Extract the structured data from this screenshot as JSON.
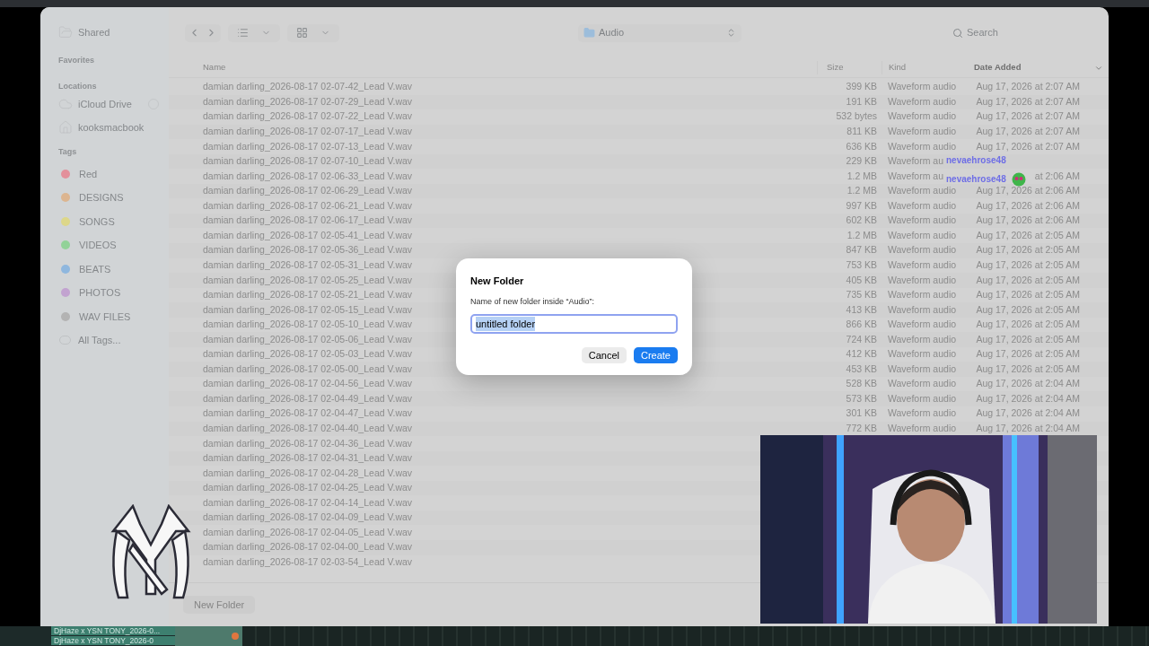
{
  "sidebar": {
    "shared": "Shared",
    "favorites_header": "Favorites",
    "locations_header": "Locations",
    "locations": [
      {
        "label": "iCloud Drive",
        "kind": "cloud"
      },
      {
        "label": "kooksmacbook",
        "kind": "home"
      }
    ],
    "tags_header": "Tags",
    "tags": [
      {
        "label": "Red",
        "color": "#e3909b"
      },
      {
        "label": "DESIGNS",
        "color": "#dcb590"
      },
      {
        "label": "SONGS",
        "color": "#ddd78a"
      },
      {
        "label": "VIDEOS",
        "color": "#92d298"
      },
      {
        "label": "BEATS",
        "color": "#8fb7de"
      },
      {
        "label": "PHOTOS",
        "color": "#c2a3d0"
      },
      {
        "label": "WAV FILES",
        "color": "#b3b3b3"
      }
    ],
    "all_tags": "All Tags..."
  },
  "toolbar": {
    "location": "Audio",
    "search_placeholder": "Search"
  },
  "table": {
    "columns": [
      {
        "label": "Name",
        "sorted": false
      },
      {
        "label": "Size",
        "sorted": false
      },
      {
        "label": "Kind",
        "sorted": false
      },
      {
        "label": "Date Added",
        "sorted": true
      }
    ],
    "rows": [
      {
        "name": "damian darling_2026-08-17 02-07-42_Lead V.wav",
        "size": "399 KB",
        "kind": "Waveform audio",
        "date": "Aug 17, 2026 at 2:07 AM"
      },
      {
        "name": "damian darling_2026-08-17 02-07-29_Lead V.wav",
        "size": "191 KB",
        "kind": "Waveform audio",
        "date": "Aug 17, 2026 at 2:07 AM"
      },
      {
        "name": "damian darling_2026-08-17 02-07-22_Lead V.wav",
        "size": "532 bytes",
        "kind": "Waveform audio",
        "date": "Aug 17, 2026 at 2:07 AM"
      },
      {
        "name": "damian darling_2026-08-17 02-07-17_Lead V.wav",
        "size": "811 KB",
        "kind": "Waveform audio",
        "date": "Aug 17, 2026 at 2:07 AM"
      },
      {
        "name": "damian darling_2026-08-17 02-07-13_Lead V.wav",
        "size": "636 KB",
        "kind": "Waveform audio",
        "date": "Aug 17, 2026 at 2:07 AM"
      },
      {
        "name": "damian darling_2026-08-17 02-07-10_Lead V.wav",
        "size": "229 KB",
        "kind": "Waveform au"
      },
      {
        "name": "damian darling_2026-08-17 02-06-33_Lead V.wav",
        "size": "1.2 MB",
        "kind": "Waveform au",
        "date": "at 2:06 AM"
      },
      {
        "name": "damian darling_2026-08-17 02-06-29_Lead V.wav",
        "size": "1.2 MB",
        "kind": "Waveform audio",
        "date": "Aug 17, 2026 at 2:06 AM"
      },
      {
        "name": "damian darling_2026-08-17 02-06-21_Lead V.wav",
        "size": "997 KB",
        "kind": "Waveform audio",
        "date": "Aug 17, 2026 at 2:06 AM"
      },
      {
        "name": "damian darling_2026-08-17 02-06-17_Lead V.wav",
        "size": "602 KB",
        "kind": "Waveform audio",
        "date": "Aug 17, 2026 at 2:06 AM"
      },
      {
        "name": "damian darling_2026-08-17 02-05-41_Lead V.wav",
        "size": "1.2 MB",
        "kind": "Waveform audio",
        "date": "Aug 17, 2026 at 2:05 AM"
      },
      {
        "name": "damian darling_2026-08-17 02-05-36_Lead V.wav",
        "size": "847 KB",
        "kind": "Waveform audio",
        "date": "Aug 17, 2026 at 2:05 AM"
      },
      {
        "name": "damian darling_2026-08-17 02-05-31_Lead V.wav",
        "size": "753 KB",
        "kind": "Waveform audio",
        "date": "Aug 17, 2026 at 2:05 AM"
      },
      {
        "name": "damian darling_2026-08-17 02-05-25_Lead V.wav",
        "size": "405 KB",
        "kind": "Waveform audio",
        "date": "Aug 17, 2026 at 2:05 AM"
      },
      {
        "name": "damian darling_2026-08-17 02-05-21_Lead V.wav",
        "size": "735 KB",
        "kind": "Waveform audio",
        "date": "Aug 17, 2026 at 2:05 AM"
      },
      {
        "name": "damian darling_2026-08-17 02-05-15_Lead V.wav",
        "size": "413 KB",
        "kind": "Waveform audio",
        "date": "Aug 17, 2026 at 2:05 AM"
      },
      {
        "name": "damian darling_2026-08-17 02-05-10_Lead V.wav",
        "size": "866 KB",
        "kind": "Waveform audio",
        "date": "Aug 17, 2026 at 2:05 AM"
      },
      {
        "name": "damian darling_2026-08-17 02-05-06_Lead V.wav",
        "size": "724 KB",
        "kind": "Waveform audio",
        "date": "Aug 17, 2026 at 2:05 AM"
      },
      {
        "name": "damian darling_2026-08-17 02-05-03_Lead V.wav",
        "size": "412 KB",
        "kind": "Waveform audio",
        "date": "Aug 17, 2026 at 2:05 AM"
      },
      {
        "name": "damian darling_2026-08-17 02-05-00_Lead V.wav",
        "size": "453 KB",
        "kind": "Waveform audio",
        "date": "Aug 17, 2026 at 2:05 AM"
      },
      {
        "name": "damian darling_2026-08-17 02-04-56_Lead V.wav",
        "size": "528 KB",
        "kind": "Waveform audio",
        "date": "Aug 17, 2026 at 2:04 AM"
      },
      {
        "name": "damian darling_2026-08-17 02-04-49_Lead V.wav",
        "size": "573 KB",
        "kind": "Waveform audio",
        "date": "Aug 17, 2026 at 2:04 AM"
      },
      {
        "name": "damian darling_2026-08-17 02-04-47_Lead V.wav",
        "size": "301 KB",
        "kind": "Waveform audio",
        "date": "Aug 17, 2026 at 2:04 AM"
      },
      {
        "name": "damian darling_2026-08-17 02-04-40_Lead V.wav",
        "size": "772 KB",
        "kind": "Waveform audio",
        "date": "Aug 17, 2026 at 2:04 AM"
      },
      {
        "name": "damian darling_2026-08-17 02-04-36_Lead V.wav"
      },
      {
        "name": "damian darling_2026-08-17 02-04-31_Lead V.wav"
      },
      {
        "name": "damian darling_2026-08-17 02-04-28_Lead V.wav"
      },
      {
        "name": "damian darling_2026-08-17 02-04-25_Lead V.wav"
      },
      {
        "name": "damian darling_2026-08-17 02-04-14_Lead V.wav"
      },
      {
        "name": "damian darling_2026-08-17 02-04-09_Lead V.wav"
      },
      {
        "name": "damian darling_2026-08-17 02-04-05_Lead V.wav"
      },
      {
        "name": "damian darling_2026-08-17 02-04-00_Lead V.wav"
      },
      {
        "name": "damian darling_2026-08-17 02-03-54_Lead V.wav"
      }
    ]
  },
  "footer": {
    "new_folder": "New Folder"
  },
  "dialog": {
    "title": "New Folder",
    "prompt": "Name of new folder inside “Audio”:",
    "field": {
      "value": "untitled folder",
      "selected": true
    },
    "buttons": [
      {
        "label": "Cancel",
        "primary": false
      },
      {
        "label": "Create",
        "primary": true
      }
    ]
  },
  "chat": [
    {
      "user": "nevaehrose48",
      "kind": "text"
    },
    {
      "user": "nevaehrose48",
      "kind": "emote"
    }
  ],
  "taskbar": [
    "DjHaze x YSN TONY_2026-0...",
    "DjHaze x YSN TONY_2026-0"
  ]
}
